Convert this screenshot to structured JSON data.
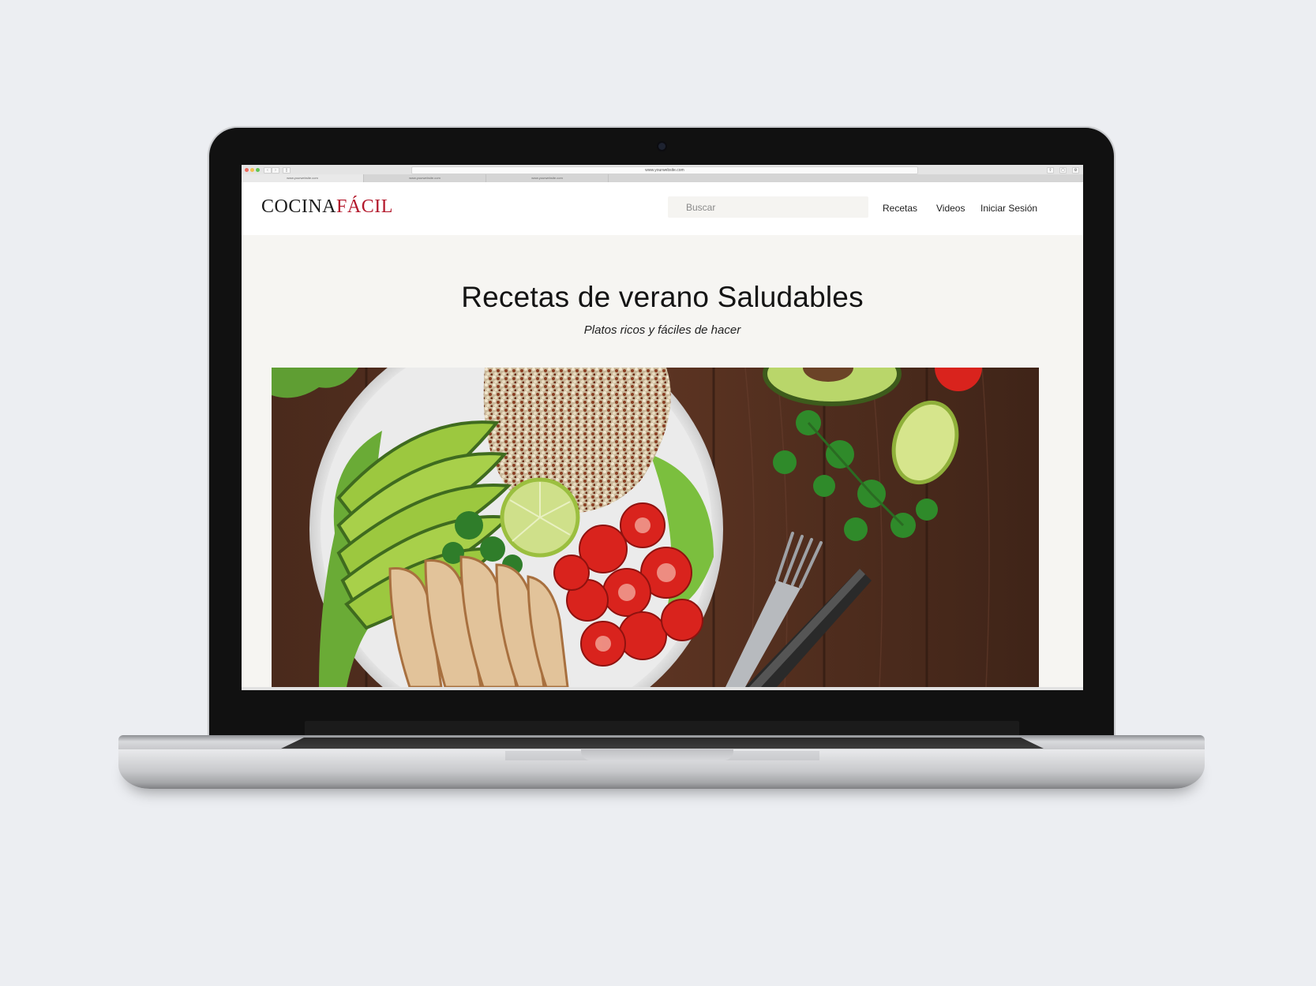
{
  "browser": {
    "url": "www.yourwebsite.com",
    "tabs": [
      "www.yourwebsite.com",
      "www.yourwebsite.com",
      "www.yourwebsite.com"
    ]
  },
  "site": {
    "logo_part1": "COCINA",
    "logo_part2": "FÁCIL",
    "search_placeholder": "Buscar",
    "nav": [
      "Recetas",
      "Videos",
      "Iniciar Sesión"
    ]
  },
  "hero": {
    "title": "Recetas de verano Saludables",
    "subtitle": "Platos ricos y fáciles de hacer",
    "image_alt": "Bowl con aguacate, quinoa, pollo, tomates y lechuga"
  },
  "colors": {
    "brand_dark": "#1c1c1c",
    "brand_accent": "#b3182b",
    "page_background": "#f6f5f2",
    "header_background": "#ffffff"
  }
}
